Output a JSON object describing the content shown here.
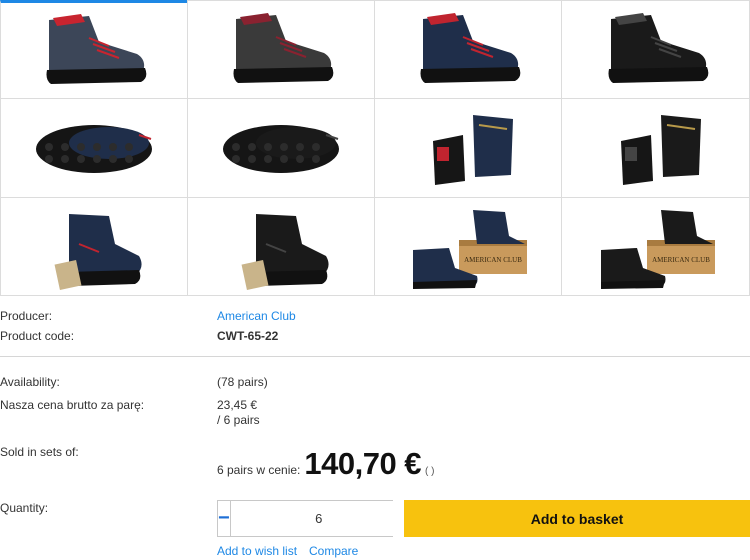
{
  "gallery": {
    "thumbnails": [
      {
        "name": "boot-side-navy-grey-red",
        "color": "#3c4658",
        "accent": "#c8242f"
      },
      {
        "name": "boot-side-grey-black",
        "color": "#3a3a3a",
        "accent": "#8a2230"
      },
      {
        "name": "boot-side-navy-black",
        "color": "#1f2e4a",
        "accent": "#c0242f"
      },
      {
        "name": "boot-side-black",
        "color": "#1a1a1a",
        "accent": "#444444"
      },
      {
        "name": "sole-navy",
        "color": "#1f2e4a",
        "accent": "#c0242f"
      },
      {
        "name": "sole-black",
        "color": "#1a1a1a",
        "accent": "#444444"
      },
      {
        "name": "pair-back-navy",
        "color": "#1f2e4a",
        "accent": "#c0242f"
      },
      {
        "name": "pair-back-black",
        "color": "#1a1a1a",
        "accent": "#444444"
      },
      {
        "name": "boot-tag-navy",
        "color": "#1f2e4a",
        "accent": "#c0242f"
      },
      {
        "name": "boot-tag-black",
        "color": "#1a1a1a",
        "accent": "#444444"
      },
      {
        "name": "box-navy",
        "color": "#1f2e4a",
        "accent": "#c0242f"
      },
      {
        "name": "box-black",
        "color": "#1a1a1a",
        "accent": "#444444"
      }
    ]
  },
  "details": {
    "producer_label": "Producer:",
    "producer_value": "American Club",
    "code_label": "Product code:",
    "code_value": "CWT-65-22",
    "availability_label": "Availability:",
    "availability_value": "(78 pairs)",
    "price_label": "Nasza cena brutto za parę:",
    "price_value": "23,45 €",
    "price_unit": "/ 6 pairs",
    "sets_label": "Sold in sets of:",
    "sets_prefix": "6 pairs w cenie:",
    "sets_price": "140,70 €",
    "sets_suffix": "( )"
  },
  "quantity": {
    "label": "Quantity:",
    "minus": "−",
    "plus": "+",
    "value": "6"
  },
  "actions": {
    "add_to_basket": "Add to basket",
    "wish_list": "Add to wish list",
    "compare": "Compare"
  },
  "colors": {
    "link": "#1e88e5",
    "basket": "#f7c20e"
  }
}
